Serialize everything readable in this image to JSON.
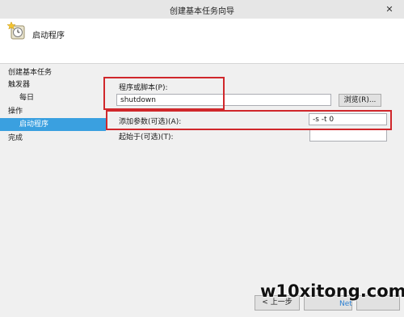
{
  "window": {
    "title": "创建基本任务向导",
    "close_glyph": "✕"
  },
  "header": {
    "title": "启动程序",
    "icon": "scheduler-clock-icon"
  },
  "sidebar": {
    "items": [
      {
        "label": "创建基本任务",
        "level": 0,
        "active": false
      },
      {
        "label": "触发器",
        "level": 0,
        "active": false
      },
      {
        "label": "每日",
        "level": 1,
        "active": false
      },
      {
        "label": "操作",
        "level": 0,
        "active": false
      },
      {
        "label": "启动程序",
        "level": 1,
        "active": true
      },
      {
        "label": "完成",
        "level": 0,
        "active": false
      }
    ]
  },
  "form": {
    "program_label": "程序或脚本(P):",
    "program_value": "shutdown",
    "browse_label": "浏览(R)...",
    "args_label": "添加参数(可选)(A):",
    "args_value": "-s -t 0",
    "start_in_label": "起始于(可选)(T):",
    "start_in_value": ""
  },
  "footer": {
    "back_label": "< 上一步"
  },
  "watermark": {
    "main": "w10xitong.com",
    "sub": "Net"
  },
  "colors": {
    "highlight": "#d0272b",
    "active": "#3aa0e0"
  }
}
